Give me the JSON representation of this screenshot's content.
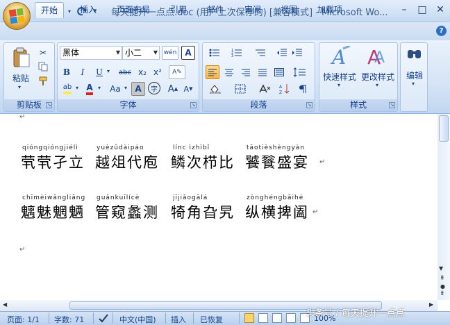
{
  "window": {
    "title": "每天提升一点点.doc (用户上次保存的) [兼容模式] - Microsoft Wo...",
    "minimize": "–",
    "maximize": "□",
    "close": "✕"
  },
  "tabs": [
    "开始",
    "插入",
    "页面布局",
    "引用",
    "邮件",
    "审阅",
    "视图",
    "加载项"
  ],
  "help": "?",
  "ribbon": {
    "clipboard": {
      "label": "剪贴板",
      "paste": "粘贴"
    },
    "font": {
      "label": "字体",
      "font_name": "黑体",
      "font_size": "小二",
      "wen": "wén",
      "A_box": "A",
      "bold": "B",
      "italic": "I",
      "underline": "U",
      "strike": "abc",
      "sub": "x₂",
      "sup": "x²",
      "change_case": "Aa",
      "char_shade": "A",
      "enclose": "字",
      "grow": "A",
      "shrink": "A",
      "highlight": "ab",
      "font_color": "A"
    },
    "paragraph": {
      "label": "段落"
    },
    "styles": {
      "label": "样式",
      "quick_styles": "快速样式",
      "change_styles": "更改样式"
    },
    "editing": {
      "label": "编辑"
    }
  },
  "document": {
    "lines": [
      {
        "pinyin": [
          "qióngqióngjiélì",
          "yuèzǔdàipáo",
          "línc ìzhìbǐ",
          "tāotièshèngyàn"
        ],
        "hanzi": [
          "茕茕孑立",
          "越俎代庖",
          "鳞次栉比",
          "饕餮盛宴"
        ]
      },
      {
        "pinyin": [
          "chīmèiwǎngliǎng",
          "guǎnkuīlícè",
          "jījiǎogālá",
          "zònghéngbǎihé"
        ],
        "hanzi": [
          "魑魅魍魉",
          "管窥蠡测",
          "犄角旮旯",
          "纵横捭阖"
        ]
      }
    ],
    "para_mark": "↵"
  },
  "status": {
    "page": "页面: 1/1",
    "words": "字数: 71",
    "language": "中文(中国)",
    "insert": "插入",
    "recovered": "已恢复",
    "zoom": "100%"
  },
  "watermark": "头条号 / 每天提升一点点",
  "colors": {
    "accent": "#15428b",
    "highlight": "#ffe94d",
    "font_color": "#e0201b"
  },
  "icons": [
    "office-button-icon",
    "save-icon",
    "undo-icon",
    "redo-icon",
    "paste-icon",
    "cut-icon",
    "copy-icon",
    "format-painter-icon",
    "quick-styles-icon",
    "change-styles-icon",
    "find-icon"
  ]
}
